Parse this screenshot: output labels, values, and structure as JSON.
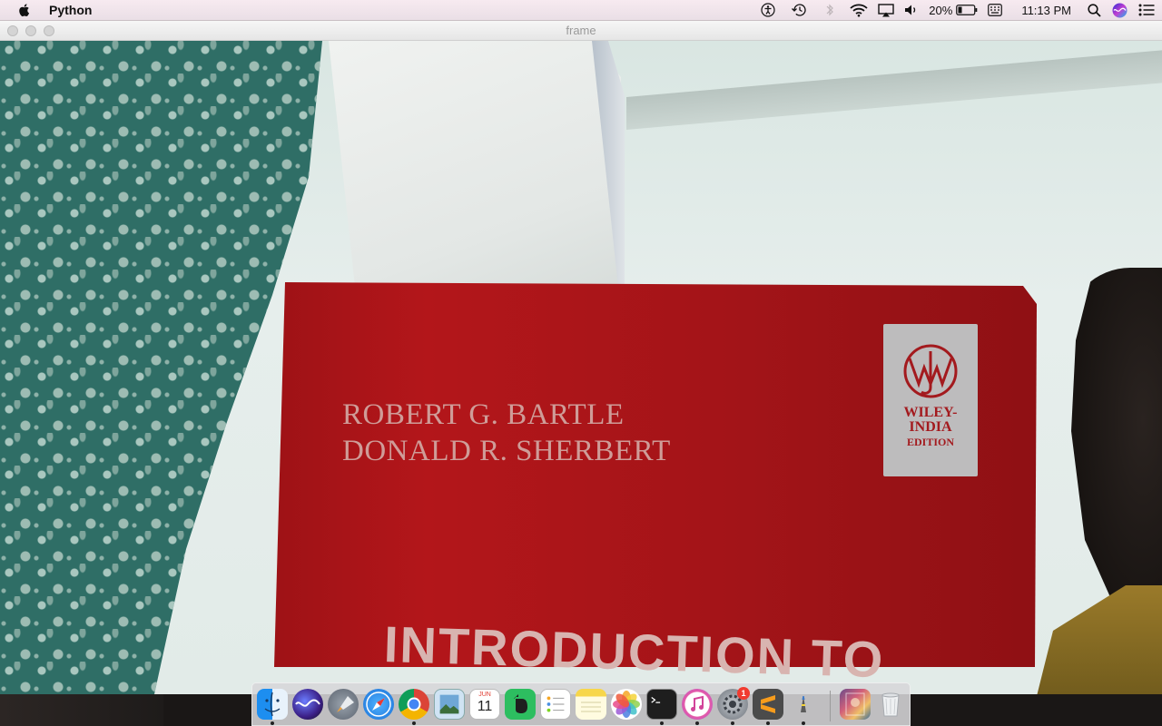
{
  "menubar": {
    "app_name": "Python",
    "battery_percent": "20%",
    "time": "11:13 PM",
    "icons": [
      "apple-icon",
      "accessibility-icon",
      "time-machine-icon",
      "bluetooth-icon",
      "wifi-icon",
      "airplay-icon",
      "volume-icon",
      "battery-icon",
      "input-source-icon",
      "spotlight-icon",
      "siri-icon",
      "notification-center-icon"
    ]
  },
  "window": {
    "title": "frame"
  },
  "camera_frame": {
    "book": {
      "authors": [
        "ROBERT G. BARTLE",
        "DONALD R. SHERBERT"
      ],
      "title": "INTRODUCTION TO",
      "publisher_lines": [
        "WILEY-",
        "INDIA",
        "EDITION"
      ]
    }
  },
  "dock": {
    "apps": [
      {
        "name": "finder-icon",
        "running": true
      },
      {
        "name": "siri-icon",
        "running": false
      },
      {
        "name": "launchpad-icon",
        "running": false
      },
      {
        "name": "safari-icon",
        "running": false
      },
      {
        "name": "chrome-icon",
        "running": true
      },
      {
        "name": "preview-icon",
        "running": false
      },
      {
        "name": "calendar-icon",
        "running": false,
        "month": "JUN",
        "day": "11"
      },
      {
        "name": "evernote-icon",
        "running": false
      },
      {
        "name": "reminders-icon",
        "running": false
      },
      {
        "name": "notes-icon",
        "running": false
      },
      {
        "name": "photos-icon",
        "running": false
      },
      {
        "name": "terminal-icon",
        "running": true
      },
      {
        "name": "itunes-icon",
        "running": true
      },
      {
        "name": "system-preferences-icon",
        "running": true,
        "badge": "1"
      },
      {
        "name": "sublime-text-icon",
        "running": true
      },
      {
        "name": "python-launcher-icon",
        "running": true
      },
      {
        "name": "downloads-stack-icon",
        "running": false
      },
      {
        "name": "trash-icon",
        "running": false
      }
    ],
    "colors": {
      "badge": "#f13b30",
      "book_red": "#a31418"
    }
  }
}
